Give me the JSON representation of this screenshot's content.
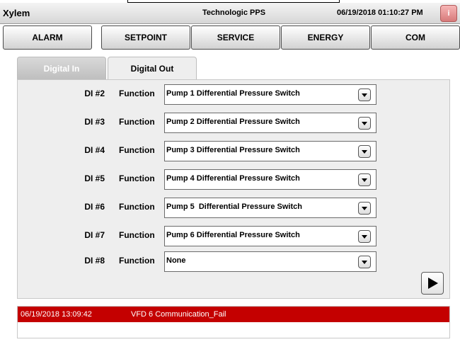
{
  "title_bar": {
    "app_name": "Xylem",
    "system_name": "Technologic PPS",
    "datetime": "06/19/2018 01:10:27 PM",
    "info_button": "i"
  },
  "nav": [
    {
      "label": "ALARM"
    },
    {
      "label": "SETPOINT"
    },
    {
      "label": "SERVICE"
    },
    {
      "label": "ENERGY"
    },
    {
      "label": "COM"
    }
  ],
  "tabs": {
    "digital_in": "Digital In",
    "digital_out": "Digital Out",
    "active": "Digital In"
  },
  "rows": [
    {
      "di": "DI #2",
      "function_label": "Function",
      "value": "Pump 1 Differential Pressure Switch"
    },
    {
      "di": "DI #3",
      "function_label": "Function",
      "value": "Pump 2 Differential Pressure Switch"
    },
    {
      "di": "DI #4",
      "function_label": "Function",
      "value": "Pump 3 Differential Pressure Switch"
    },
    {
      "di": "DI #5",
      "function_label": "Function",
      "value": "Pump 4 Differential Pressure Switch"
    },
    {
      "di": "DI #6",
      "function_label": "Function",
      "value": "Pump 5  Differential Pressure Switch"
    },
    {
      "di": "DI #7",
      "function_label": "Function",
      "value": "Pump 6 Differential Pressure Switch"
    },
    {
      "di": "DI #8",
      "function_label": "Function",
      "value": "None"
    }
  ],
  "alarm": {
    "timestamp": "06/19/2018 13:09:42",
    "message": "VFD 6 Communication_Fail",
    "color": "#c40000"
  },
  "icons": {
    "dropdown": "chevron-down-icon",
    "next": "play-arrow-icon"
  }
}
